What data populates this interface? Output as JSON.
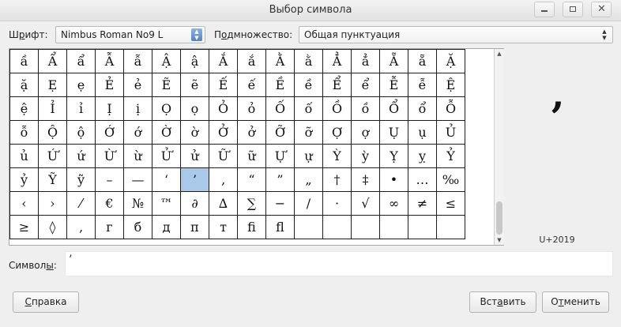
{
  "window": {
    "title": "Выбор символа"
  },
  "font_row": {
    "font_label_prefix": "Ш",
    "font_label_underlined": "р",
    "font_label_suffix": "ифт:",
    "font_value": "Nimbus Roman No9 L",
    "subset_label_prefix": "П",
    "subset_label_underlined": "о",
    "subset_label_suffix": "дмножество:",
    "subset_value": "Общая пунктуация"
  },
  "glyph_grid": {
    "rows": [
      [
        "ầ",
        "Ẩ",
        "ẩ",
        "Ẫ",
        "ẫ",
        "Ậ",
        "ậ",
        "Ắ",
        "ắ",
        "Ằ",
        "ằ",
        "Ẳ",
        "ẳ",
        "Ẵ",
        "ẵ",
        "Ặ"
      ],
      [
        "ặ",
        "Ẹ",
        "ẹ",
        "Ẻ",
        "ẻ",
        "Ẽ",
        "ẽ",
        "Ế",
        "ế",
        "Ề",
        "ề",
        "Ể",
        "ể",
        "Ễ",
        "ễ",
        "Ệ"
      ],
      [
        "ệ",
        "Ỉ",
        "ỉ",
        "Ị",
        "ị",
        "Ọ",
        "ọ",
        "Ỏ",
        "ỏ",
        "Ố",
        "ố",
        "Ồ",
        "ồ",
        "Ổ",
        "ổ",
        "Ỗ"
      ],
      [
        "ỗ",
        "Ộ",
        "ộ",
        "Ớ",
        "ớ",
        "Ờ",
        "ờ",
        "Ở",
        "ở",
        "Ỡ",
        "ỡ",
        "Ợ",
        "ợ",
        "Ụ",
        "ụ",
        "Ủ"
      ],
      [
        "ủ",
        "Ứ",
        "ứ",
        "Ừ",
        "ừ",
        "Ử",
        "ử",
        "Ữ",
        "ữ",
        "Ự",
        "ự",
        "Ỳ",
        "ỳ",
        "Ỵ",
        "ỵ",
        "Ỷ"
      ],
      [
        "ỷ",
        "Ỹ",
        "ỹ",
        "–",
        "—",
        "‘",
        "’",
        "‚",
        "“",
        "”",
        "„",
        "†",
        "‡",
        "•",
        "…",
        "‰"
      ],
      [
        "‹",
        "›",
        "⁄",
        "€",
        "№",
        "™",
        "∂",
        "∆",
        "∑",
        "−",
        "∕",
        "·",
        "√",
        "∞",
        "≠",
        "≤"
      ],
      [
        "≥",
        "◊",
        "‚",
        "г",
        "б",
        "д",
        "п",
        "т",
        "ﬁ",
        "ﬂ",
        "",
        "",
        "",
        "",
        "",
        ""
      ]
    ],
    "selected": "’"
  },
  "preview": {
    "glyph": "’",
    "codepoint": "U+2019"
  },
  "symbols_row": {
    "label_prefix": "Символ",
    "label_underlined": "ы",
    "label_suffix": ":",
    "value": "’"
  },
  "buttons": {
    "help_underlined": "С",
    "help_rest": "правка",
    "insert_prefix": "Вст",
    "insert_underlined": "а",
    "insert_suffix": "вить",
    "cancel_prefix": "О",
    "cancel_underlined": "т",
    "cancel_suffix": "менить"
  },
  "icons": {
    "minimize": "minimize-icon",
    "maximize": "maximize-icon",
    "close": "close-icon",
    "combo_arrow": "updown-arrows-icon",
    "scroll_up": "scroll-up-icon",
    "scroll_down": "scroll-down-icon"
  }
}
